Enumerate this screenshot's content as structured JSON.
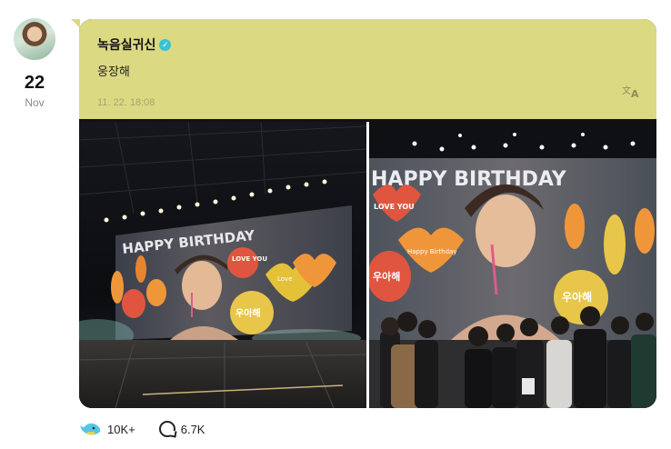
{
  "post": {
    "day": "22",
    "month": "Nov",
    "author_name": "녹음실귀신",
    "verified_mark": "✓",
    "message": "웅장해",
    "timestamp": "11. 22. 18:08",
    "translate_icon": "translate-icon"
  },
  "photo_left": {
    "screen_text_top": "HAPPY BIRTHDAY",
    "balloon_love": "LOVE YOU",
    "balloon_name": "우아해",
    "balloon_heart": "Love"
  },
  "photo_right": {
    "screen_text_top": "HAPPY BIRTHDAY",
    "balloon_love": "LOVE YOU",
    "balloon_name": "우아해",
    "balloon_heart": "Happy Birthday",
    "balloon_small": "우아해"
  },
  "reactions": {
    "like_count": "10K+",
    "comment_count": "6.7K"
  },
  "colors": {
    "message_bg": "#dcd983",
    "verified": "#35c3d6"
  }
}
